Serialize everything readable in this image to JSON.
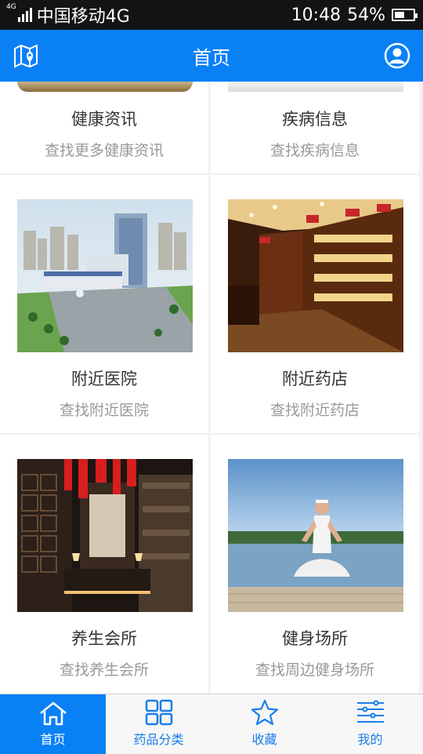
{
  "status_bar": {
    "network_icon_label": "4G",
    "carrier": "中国移动4G",
    "time": "10:48",
    "battery_percent": "54%",
    "battery_level": 0.54
  },
  "header": {
    "title": "首页",
    "left_icon": "map-icon",
    "right_icon": "user-icon"
  },
  "grid": [
    {
      "name": "健康资讯",
      "desc": "查找更多健康资讯"
    },
    {
      "name": "疾病信息",
      "desc": "查找疾病信息"
    },
    {
      "name": "附近医院",
      "desc": "查找附近医院"
    },
    {
      "name": "附近药店",
      "desc": "查找附近药店"
    },
    {
      "name": "养生会所",
      "desc": "查找养生会所"
    },
    {
      "name": "健身场所",
      "desc": "查找周边健身场所"
    }
  ],
  "tabs": [
    {
      "label": "首页",
      "icon": "home-icon",
      "active": true
    },
    {
      "label": "药品分类",
      "icon": "grid-icon",
      "active": false
    },
    {
      "label": "收藏",
      "icon": "star-icon",
      "active": false
    },
    {
      "label": "我的",
      "icon": "settings-sliders-icon",
      "active": false
    }
  ],
  "colors": {
    "primary": "#0a80f5",
    "status_bar": "#141414",
    "background": "#f2f2f2"
  }
}
